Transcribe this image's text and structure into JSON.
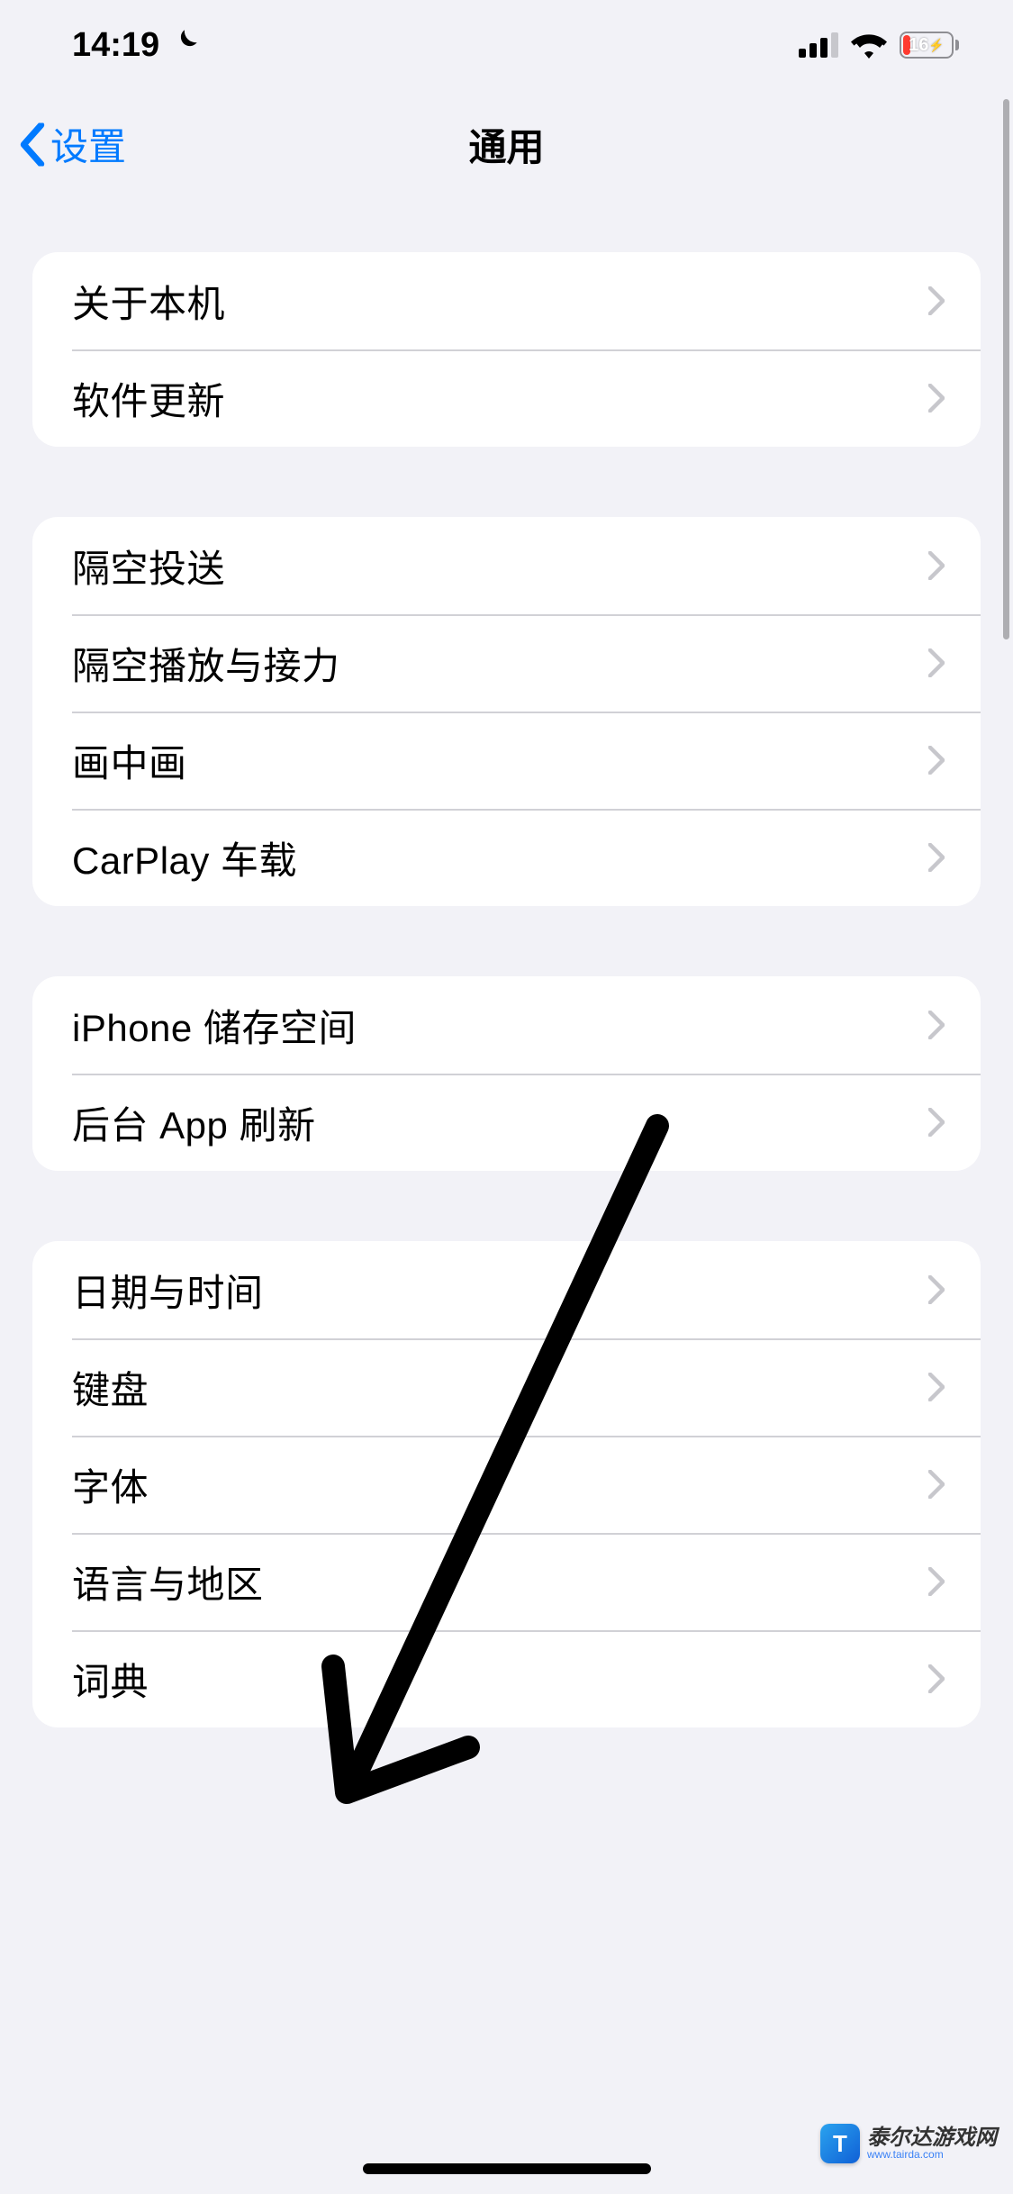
{
  "status": {
    "time": "14:19",
    "dnd": true,
    "battery_text": "16"
  },
  "nav": {
    "back_label": "设置",
    "title": "通用"
  },
  "groups": [
    {
      "items": [
        {
          "key": "about",
          "label": "关于本机"
        },
        {
          "key": "software-update",
          "label": "软件更新"
        }
      ]
    },
    {
      "items": [
        {
          "key": "airdrop",
          "label": "隔空投送"
        },
        {
          "key": "airplay-handoff",
          "label": "隔空播放与接力"
        },
        {
          "key": "pip",
          "label": "画中画"
        },
        {
          "key": "carplay",
          "label": "CarPlay 车载"
        }
      ]
    },
    {
      "items": [
        {
          "key": "iphone-storage",
          "label": "iPhone 储存空间"
        },
        {
          "key": "background-app-refresh",
          "label": "后台 App 刷新"
        }
      ]
    },
    {
      "items": [
        {
          "key": "date-time",
          "label": "日期与时间"
        },
        {
          "key": "keyboard",
          "label": "键盘"
        },
        {
          "key": "fonts",
          "label": "字体"
        },
        {
          "key": "language-region",
          "label": "语言与地区"
        },
        {
          "key": "dictionary",
          "label": "词典"
        }
      ]
    }
  ],
  "watermark": {
    "badge": "T",
    "main": "泰尔达游戏网",
    "sub": "www.tairda.com"
  }
}
